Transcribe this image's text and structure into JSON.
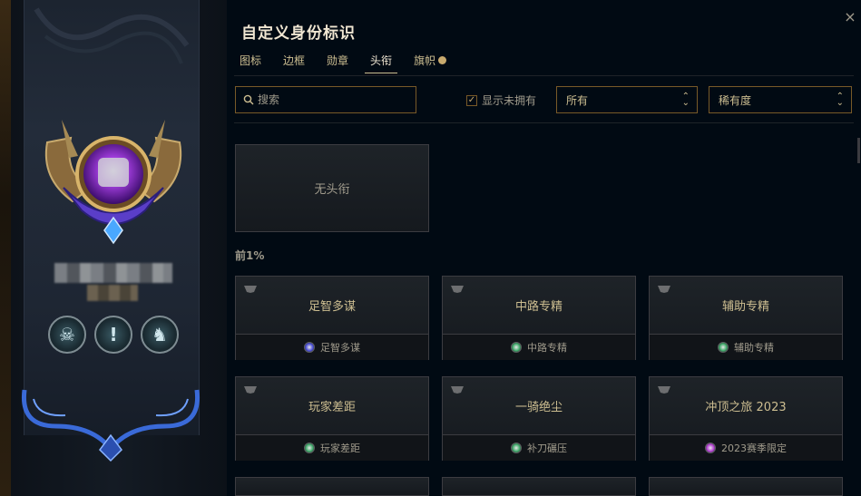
{
  "window": {
    "title": "自定义身份标识",
    "close_icon": "×"
  },
  "tabs": [
    {
      "label": "图标",
      "active": false
    },
    {
      "label": "边框",
      "active": false
    },
    {
      "label": "勋章",
      "active": false
    },
    {
      "label": "头衔",
      "active": true
    },
    {
      "label": "旗帜",
      "active": false,
      "has_notification_dot": true
    }
  ],
  "filters": {
    "search_placeholder": "搜索",
    "show_unowned_label": "显示未拥有",
    "show_unowned_checked": true,
    "ownership_select": "所有",
    "sort_select": "稀有度"
  },
  "no_title_card": {
    "label": "无头衔"
  },
  "section": {
    "label": "前1%"
  },
  "title_cards": [
    {
      "title": "足智多谋",
      "source": "足智多谋",
      "orb_color": "#4b4fd6"
    },
    {
      "title": "中路专精",
      "source": "中路专精",
      "orb_color": "#3fa86a"
    },
    {
      "title": "辅助专精",
      "source": "辅助专精",
      "orb_color": "#3fa86a"
    },
    {
      "title": "玩家差距",
      "source": "玩家差距",
      "orb_color": "#3fa86a"
    },
    {
      "title": "一骑绝尘",
      "source": "补刀碾压",
      "orb_color": "#3fa86a"
    },
    {
      "title": "冲顶之旅 2023",
      "source": "2023赛季限定",
      "orb_color": "#b23fd1"
    }
  ],
  "banner": {
    "badges": [
      {
        "icon": "mask-icon",
        "glyph": "☠"
      },
      {
        "icon": "exclamation-icon",
        "glyph": "!"
      },
      {
        "icon": "wolf-icon",
        "glyph": "♞"
      }
    ]
  }
}
